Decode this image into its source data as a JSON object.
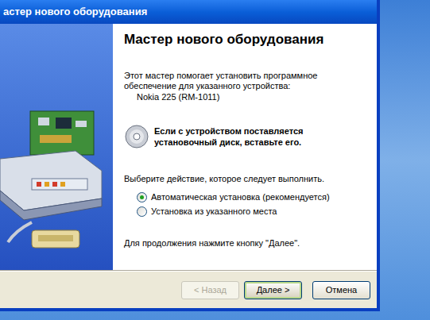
{
  "window": {
    "title": "астер нового оборудования"
  },
  "heading": "Мастер нового оборудования",
  "intro": "Этот мастер помогает установить программное обеспечение для указанного устройства:",
  "device": "Nokia 225 (RM-1011)",
  "disk_hint": "Если с устройством поставляется установочный диск, вставьте его.",
  "prompt": "Выберите действие, которое следует выполнить.",
  "options": [
    {
      "label": "Автоматическая установка (рекомендуется)",
      "selected": true
    },
    {
      "label": "Установка из указанного места",
      "selected": false
    }
  ],
  "footer": "Для продолжения нажмите кнопку \"Далее\".",
  "buttons": [
    {
      "label": "< Назад",
      "disabled": true,
      "default": false
    },
    {
      "label": "Далее >",
      "disabled": false,
      "default": true
    },
    {
      "label": "Отмена",
      "disabled": false,
      "default": false
    }
  ]
}
